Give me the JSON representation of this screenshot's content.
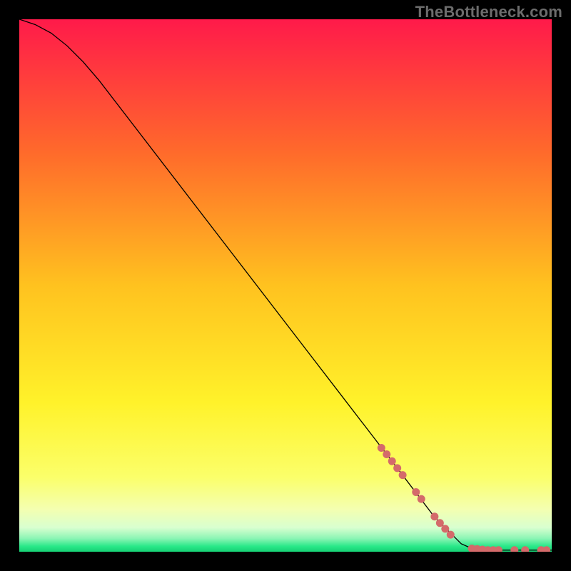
{
  "watermark": "TheBottleneck.com",
  "chart_data": {
    "type": "line",
    "title": "",
    "xlabel": "",
    "ylabel": "",
    "xlim": [
      0,
      100
    ],
    "ylim": [
      0,
      100
    ],
    "background_gradient": {
      "stops": [
        {
          "offset": 0.0,
          "color": "#ff1a4a"
        },
        {
          "offset": 0.25,
          "color": "#ff6a2b"
        },
        {
          "offset": 0.5,
          "color": "#ffc21f"
        },
        {
          "offset": 0.72,
          "color": "#fff22a"
        },
        {
          "offset": 0.86,
          "color": "#fbff6a"
        },
        {
          "offset": 0.92,
          "color": "#f4ffb0"
        },
        {
          "offset": 0.955,
          "color": "#d8ffd0"
        },
        {
          "offset": 0.975,
          "color": "#8cf5b4"
        },
        {
          "offset": 0.99,
          "color": "#28e888"
        },
        {
          "offset": 1.0,
          "color": "#16d074"
        }
      ]
    },
    "series": [
      {
        "name": "curve",
        "type": "line",
        "color": "#000000",
        "width": 1.3,
        "points": [
          {
            "x": 0.0,
            "y": 100.0
          },
          {
            "x": 3.0,
            "y": 99.0
          },
          {
            "x": 6.0,
            "y": 97.4
          },
          {
            "x": 9.0,
            "y": 95.0
          },
          {
            "x": 12.0,
            "y": 92.0
          },
          {
            "x": 15.0,
            "y": 88.5
          },
          {
            "x": 20.0,
            "y": 82.0
          },
          {
            "x": 30.0,
            "y": 69.0
          },
          {
            "x": 40.0,
            "y": 56.0
          },
          {
            "x": 50.0,
            "y": 43.0
          },
          {
            "x": 60.0,
            "y": 30.0
          },
          {
            "x": 70.0,
            "y": 17.0
          },
          {
            "x": 78.0,
            "y": 6.5
          },
          {
            "x": 83.0,
            "y": 1.5
          },
          {
            "x": 85.0,
            "y": 0.6
          },
          {
            "x": 88.0,
            "y": 0.3
          },
          {
            "x": 100.0,
            "y": 0.3
          }
        ]
      },
      {
        "name": "dots",
        "type": "scatter",
        "color": "#d46a6a",
        "radius": 5.5,
        "points": [
          {
            "x": 68.0,
            "y": 19.5
          },
          {
            "x": 69.0,
            "y": 18.3
          },
          {
            "x": 70.0,
            "y": 17.0
          },
          {
            "x": 71.0,
            "y": 15.7
          },
          {
            "x": 72.0,
            "y": 14.4
          },
          {
            "x": 74.5,
            "y": 11.2
          },
          {
            "x": 75.5,
            "y": 9.9
          },
          {
            "x": 78.0,
            "y": 6.6
          },
          {
            "x": 79.0,
            "y": 5.4
          },
          {
            "x": 80.0,
            "y": 4.3
          },
          {
            "x": 81.0,
            "y": 3.2
          },
          {
            "x": 85.0,
            "y": 0.6
          },
          {
            "x": 86.0,
            "y": 0.5
          },
          {
            "x": 87.0,
            "y": 0.4
          },
          {
            "x": 88.0,
            "y": 0.3
          },
          {
            "x": 89.0,
            "y": 0.3
          },
          {
            "x": 90.0,
            "y": 0.3
          },
          {
            "x": 93.0,
            "y": 0.3
          },
          {
            "x": 95.0,
            "y": 0.3
          },
          {
            "x": 98.0,
            "y": 0.3
          },
          {
            "x": 99.0,
            "y": 0.3
          }
        ]
      }
    ]
  }
}
